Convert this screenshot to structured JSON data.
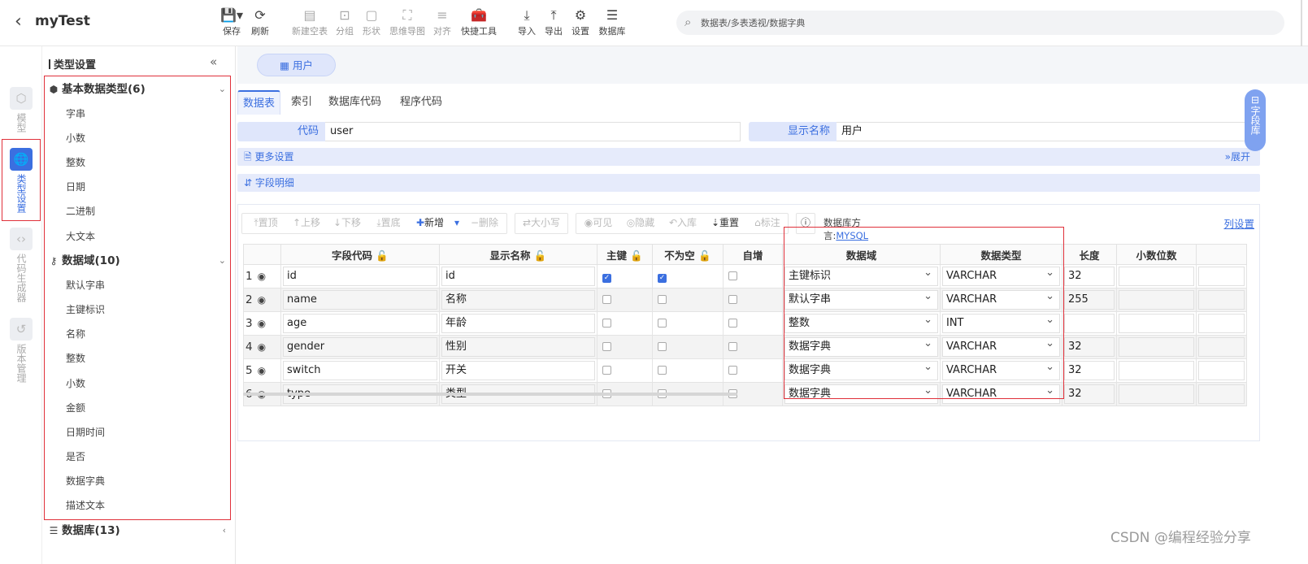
{
  "app": {
    "title": "myTest"
  },
  "toolbar": {
    "items": [
      {
        "label": "保存",
        "icon": "save-icon"
      },
      {
        "label": "刷新",
        "icon": "refresh-icon"
      },
      {
        "label": "新建空表",
        "icon": "new-table-icon"
      },
      {
        "label": "分组",
        "icon": "group-icon"
      },
      {
        "label": "形状",
        "icon": "shape-icon"
      },
      {
        "label": "思维导图",
        "icon": "mindmap-icon"
      },
      {
        "label": "对齐",
        "icon": "align-icon"
      },
      {
        "label": "快捷工具",
        "icon": "toolbox-icon"
      },
      {
        "label": "导入",
        "icon": "import-icon"
      },
      {
        "label": "导出",
        "icon": "export-icon"
      },
      {
        "label": "设置",
        "icon": "gear-icon"
      },
      {
        "label": "数据库",
        "icon": "database-icon"
      }
    ]
  },
  "search": {
    "placeholder": "数据表/多表透视/数据字典"
  },
  "rail": {
    "items": [
      {
        "label": "模型"
      },
      {
        "label": "类型设置"
      },
      {
        "label": "代码生成器"
      },
      {
        "label": "版本管理"
      }
    ]
  },
  "panel": {
    "title": "类型设置",
    "collapse_glyph": "«",
    "groups": [
      {
        "label": "基本数据类型(6)",
        "items": [
          "字串",
          "小数",
          "整数",
          "日期",
          "二进制",
          "大文本"
        ]
      },
      {
        "label": "数据域(10)",
        "items": [
          "默认字串",
          "主键标识",
          "名称",
          "整数",
          "小数",
          "金额",
          "日期时间",
          "是否",
          "数据字典",
          "描述文本"
        ]
      },
      {
        "label": "数据库(13)",
        "items": []
      }
    ]
  },
  "main": {
    "entity_tab": "用户",
    "subtabs": [
      "数据表",
      "索引",
      "数据库代码",
      "程序代码"
    ],
    "code_label": "代码",
    "code_value": "user",
    "display_label": "显示名称",
    "display_value": "用户",
    "more_settings": "更多设置",
    "expand": "展开",
    "field_detail": "字段明细",
    "grid_toolbar": {
      "top": "置顶",
      "up": "上移",
      "down": "下移",
      "bottom": "置底",
      "add": "新增",
      "delete": "删除",
      "case": "大小写",
      "visible": "可见",
      "hide": "隐藏",
      "to_lib": "入库",
      "reset": "重置",
      "mark": "标注",
      "dialect_label": "数据库方言:",
      "dialect_value": "MYSQL",
      "column_settings": "列设置"
    },
    "columns": [
      "字段代码",
      "显示名称",
      "主键",
      "不为空",
      "自增",
      "数据域",
      "数据类型",
      "长度",
      "小数位数"
    ],
    "rows": [
      {
        "num": "1",
        "code": "id",
        "name": "id",
        "pk": true,
        "notnull": true,
        "auto": false,
        "domain": "主键标识",
        "type": "VARCHAR",
        "length": "32",
        "scale": ""
      },
      {
        "num": "2",
        "code": "name",
        "name": "名称",
        "pk": false,
        "notnull": false,
        "auto": false,
        "domain": "默认字串",
        "type": "VARCHAR",
        "length": "255",
        "scale": ""
      },
      {
        "num": "3",
        "code": "age",
        "name": "年龄",
        "pk": false,
        "notnull": false,
        "auto": false,
        "domain": "整数",
        "type": "INT",
        "length": "",
        "scale": ""
      },
      {
        "num": "4",
        "code": "gender",
        "name": "性别",
        "pk": false,
        "notnull": false,
        "auto": false,
        "domain": "数据字典",
        "type": "VARCHAR",
        "length": "32",
        "scale": ""
      },
      {
        "num": "5",
        "code": "switch",
        "name": "开关",
        "pk": false,
        "notnull": false,
        "auto": false,
        "domain": "数据字典",
        "type": "VARCHAR",
        "length": "32",
        "scale": ""
      },
      {
        "num": "6",
        "code": "type",
        "name": "类型",
        "pk": false,
        "notnull": false,
        "auto": false,
        "domain": "数据字典",
        "type": "VARCHAR",
        "length": "32",
        "scale": ""
      }
    ]
  },
  "side_tab": {
    "label": "字段库"
  },
  "watermark": "CSDN @编程经验分享",
  "colors": {
    "accent": "#3b6fe0",
    "highlight_border": "#e0303a"
  }
}
